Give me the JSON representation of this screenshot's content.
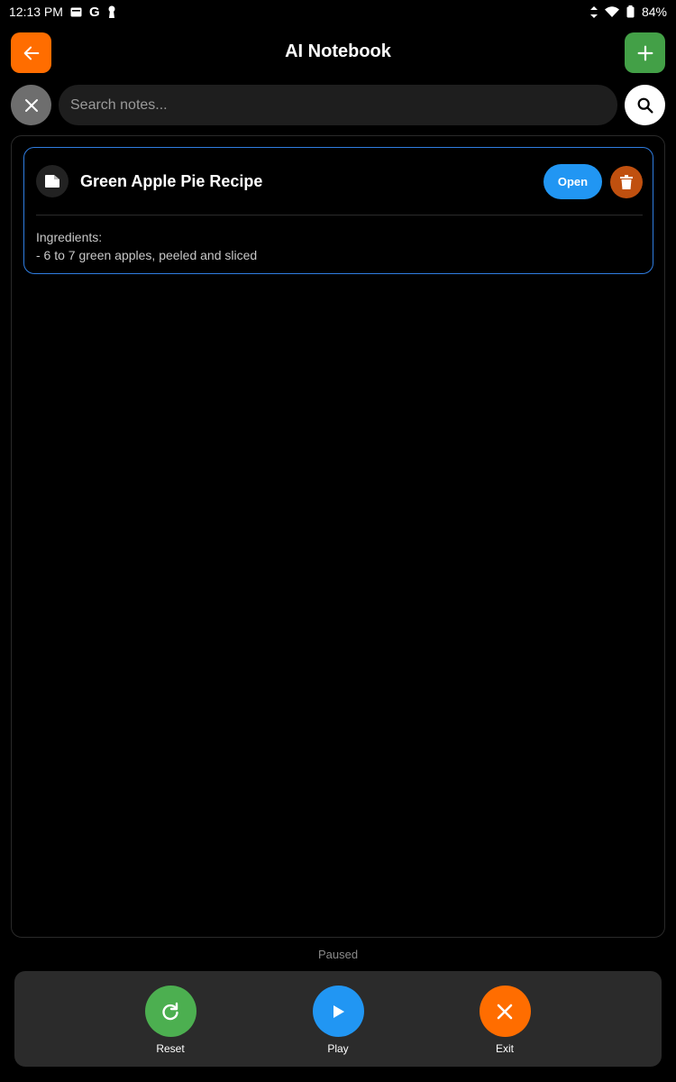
{
  "status_bar": {
    "time": "12:13 PM",
    "battery": "84%"
  },
  "header": {
    "title": "AI Notebook"
  },
  "search": {
    "placeholder": "Search notes..."
  },
  "notes": [
    {
      "title": "Green Apple Pie Recipe",
      "open_label": "Open",
      "preview_line1": "Ingredients:",
      "preview_line2": "- 6 to 7 green apples, peeled and sliced"
    }
  ],
  "playback": {
    "status": "Paused",
    "reset_label": "Reset",
    "play_label": "Play",
    "exit_label": "Exit"
  },
  "colors": {
    "back": "#ff6d00",
    "add": "#43a047",
    "accent_blue": "#2196f3",
    "delete": "#c0500f",
    "card_border": "#2f7de1"
  },
  "icons": [
    "arrow-left-icon",
    "plus-icon",
    "close-icon",
    "search-icon",
    "note-icon",
    "trash-icon",
    "refresh-icon",
    "play-icon"
  ]
}
